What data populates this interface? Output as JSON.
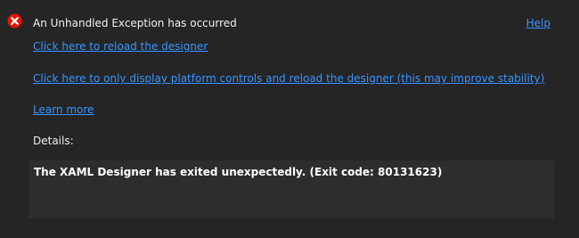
{
  "header": {
    "title": "An Unhandled Exception has occurred",
    "help_label": "Help",
    "icon": "error-x-icon",
    "icon_color": "#e51400"
  },
  "links": {
    "reload": "Click here to reload the designer",
    "platform_only": "Click here to only display platform controls and reload the designer (this may improve stability)",
    "learn_more": "Learn more"
  },
  "details": {
    "label": "Details:",
    "message": "The XAML Designer has exited unexpectedly. (Exit code: 80131623)"
  },
  "colors": {
    "background": "#252526",
    "details_background": "#2d2d30",
    "link": "#3794ff",
    "text": "#f1f1f1"
  }
}
